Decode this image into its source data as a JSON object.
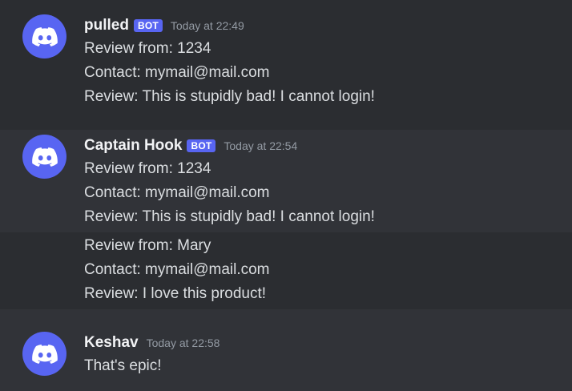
{
  "messages": [
    {
      "username": "pulled",
      "bot_tag": "BOT",
      "timestamp": "Today at 22:49",
      "lines": [
        "Review from: 1234",
        "Contact: mymail@mail.com",
        "Review: This is stupidly bad! I cannot login!"
      ]
    },
    {
      "username": "Captain Hook",
      "bot_tag": "BOT",
      "timestamp": "Today at 22:54",
      "lines": [
        "Review from: 1234",
        "Contact: mymail@mail.com",
        "Review: This is stupidly bad! I cannot login!"
      ],
      "continuation_lines": [
        "Review from: Mary",
        "Contact: mymail@mail.com",
        "Review: I love this product!"
      ]
    },
    {
      "username": "Keshav",
      "timestamp": "Today at 22:58",
      "lines": [
        "That's epic!"
      ]
    }
  ],
  "colors": {
    "background": "#313338",
    "highlight": "#2b2d31",
    "avatar": "#5865f2",
    "bot_tag": "#5865f2",
    "username": "#f2f3f5",
    "text": "#dbdee1",
    "timestamp": "#949ba4"
  },
  "icons": {
    "avatar": "discord-logo-icon"
  }
}
